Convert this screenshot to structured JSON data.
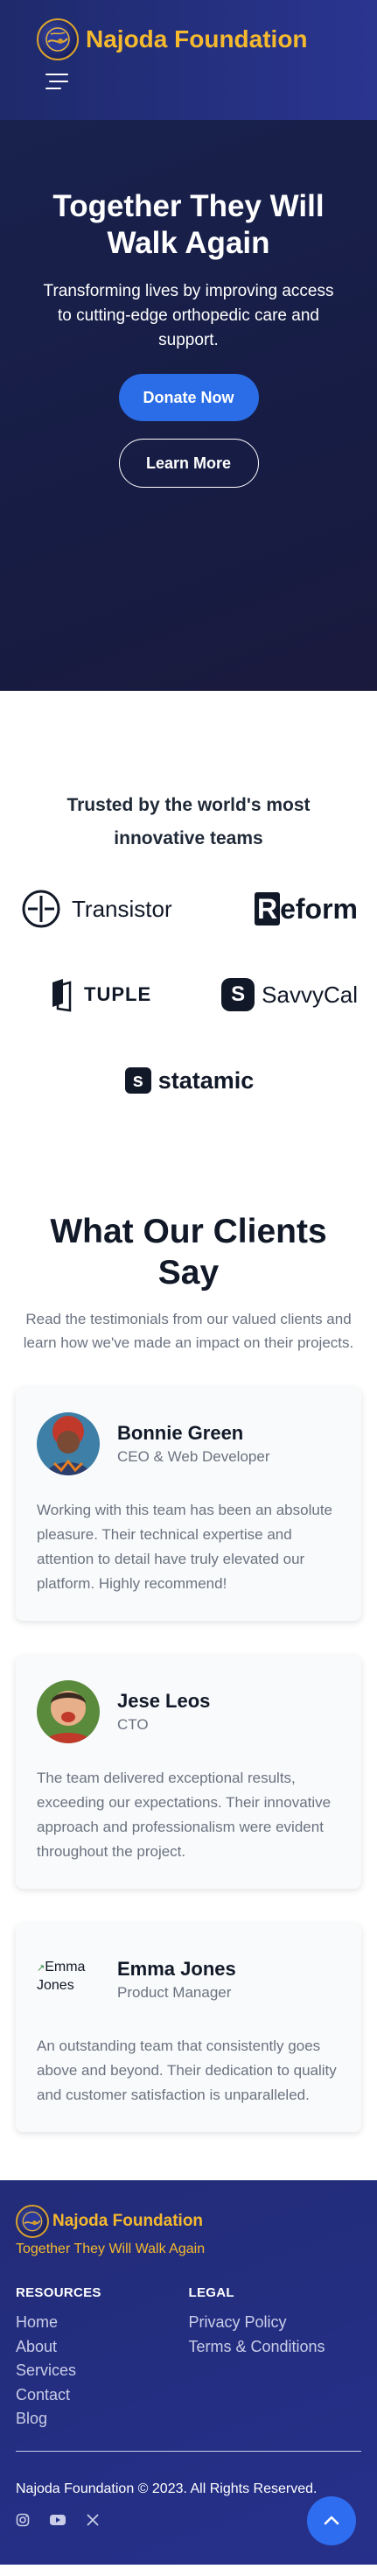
{
  "header": {
    "brand_name": "Najoda Foundation",
    "logo_icon": "globe-hand-logo",
    "menu_icon": "hamburger-icon"
  },
  "hero": {
    "title": "Together They Will Walk Again",
    "subtitle": "Transforming lives by improving access to cutting-edge orthopedic care and support.",
    "primary_button": "Donate Now",
    "secondary_button": "Learn More"
  },
  "trusted": {
    "title": "Trusted by the world's most innovative teams",
    "logos": [
      {
        "name": "Transistor",
        "prefix": ""
      },
      {
        "name": "eform",
        "prefix": "R"
      },
      {
        "name": "TUPLE",
        "prefix": ""
      },
      {
        "name": "SavvyCal",
        "prefix": "S"
      },
      {
        "name": "statamic",
        "prefix": "s"
      }
    ]
  },
  "testimonials": {
    "title": "What Our Clients Say",
    "subtitle": "Read the testimonials from our valued clients and learn how we've made an impact on their projects.",
    "items": [
      {
        "name": "Bonnie Green",
        "role": "CEO & Web Developer",
        "quote": "Working with this team has been an absolute pleasure. Their technical expertise and attention to detail have truly elevated our platform. Highly recommend!"
      },
      {
        "name": "Jese Leos",
        "role": "CTO",
        "quote": "The team delivered exceptional results, exceeding our expectations. Their innovative approach and professionalism were evident throughout the project."
      },
      {
        "name": "Emma Jones",
        "role": "Product Manager",
        "avatar_alt": "Emma Jones",
        "quote": "An outstanding team that consistently goes above and beyond. Their dedication to quality and customer satisfaction is unparalleled."
      }
    ]
  },
  "footer": {
    "brand_name": "Najoda Foundation",
    "tagline": "Together They Will Walk Again",
    "resources": {
      "heading": "RESOURCES",
      "links": [
        "Home",
        "About",
        "Services",
        "Contact",
        "Blog"
      ]
    },
    "legal": {
      "heading": "LEGAL",
      "links": [
        "Privacy Policy",
        "Terms & Conditions"
      ]
    },
    "copyright": "Najoda Foundation © 2023. All Rights Reserved.",
    "social_icons": [
      "instagram-icon",
      "youtube-icon",
      "x-icon"
    ],
    "scroll_top_icon": "chevron-up-icon"
  },
  "colors": {
    "brand_gold": "#f5b92e",
    "primary_blue": "#2a6de6",
    "navy": "#18224d",
    "footer_blue": "#26308a"
  }
}
